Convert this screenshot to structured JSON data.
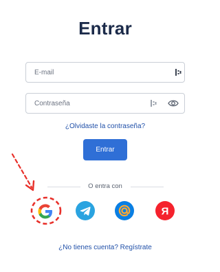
{
  "title": "Entrar",
  "form": {
    "email_placeholder": "E-mail",
    "password_placeholder": "Contraseña",
    "forgot_link": "¿Olvidaste la contraseña?",
    "submit_label": "Entrar"
  },
  "divider": {
    "text": "O entra con"
  },
  "social": {
    "items": [
      {
        "name": "google-icon"
      },
      {
        "name": "telegram-icon"
      },
      {
        "name": "mailru-icon"
      },
      {
        "name": "yandex-icon"
      }
    ],
    "yandex_letter": "Я",
    "highlight_color": "#e8302a"
  },
  "signup_link": "¿No tienes cuenta? Regístrate",
  "colors": {
    "primary": "#2f6fd6",
    "link": "#1f4fa8",
    "title": "#1c2b4a",
    "telegram": "#2aa3e0",
    "mailru": "#0a7fe3",
    "yandex": "#f5222d"
  }
}
